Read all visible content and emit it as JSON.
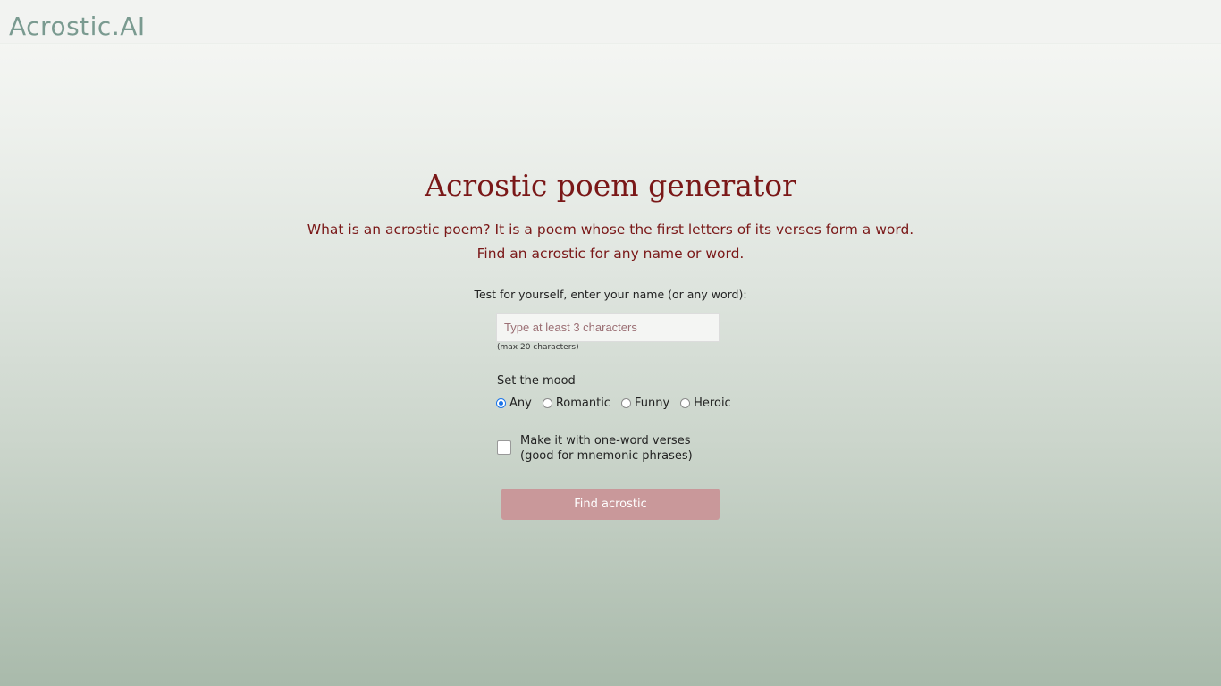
{
  "header": {
    "logo_text": "Acrostic.AI"
  },
  "main": {
    "title": "Acrostic poem generator",
    "intro_line1": "What is an acrostic poem? It is a poem whose the first letters of its verses form a word.",
    "intro_line2": "Find an acrostic for any name or word.",
    "prompt": "Test for yourself, enter your name (or any word):",
    "input": {
      "value": "",
      "placeholder": "Type at least 3 characters"
    },
    "hint": "(max 20 characters)",
    "mood": {
      "label": "Set the mood",
      "options": [
        "Any",
        "Romantic",
        "Funny",
        "Heroic"
      ],
      "selected": "Any"
    },
    "one_word": {
      "line1": "Make it with one-word verses",
      "line2": "(good for mnemonic phrases)",
      "checked": false
    },
    "submit_label": "Find acrostic"
  },
  "colors": {
    "title": "#7a1818",
    "logo": "#7a9a90",
    "button": "#c9989a",
    "radio_accent": "#1a73e8"
  }
}
